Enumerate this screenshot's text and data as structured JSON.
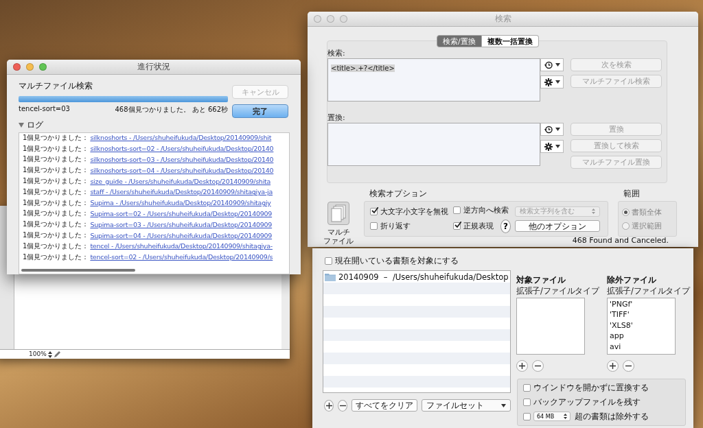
{
  "background_window": {
    "zoom": "100%"
  },
  "progress_window": {
    "title": "進行状況",
    "heading": "マルチファイル検索",
    "cancel_button": {
      "label": "キャンセル",
      "disabled": true
    },
    "progress": {
      "level": 1
    },
    "current_file": "tencel-sort=03",
    "status": "468個見つかりました。 あと 662秒",
    "done_button": "完了",
    "log": {
      "label": "ログ",
      "expanded": true,
      "entries": [
        {
          "prefix": "1個見つかりました：",
          "link": "silknoshorts  -  /Users/shuheifukuda/Desktop/20140909/shit"
        },
        {
          "prefix": "1個見つかりました：",
          "link": "silknoshorts-sort=02  -  /Users/shuheifukuda/Desktop/20140"
        },
        {
          "prefix": "1個見つかりました：",
          "link": "silknoshorts-sort=03  -  /Users/shuheifukuda/Desktop/20140"
        },
        {
          "prefix": "1個見つかりました：",
          "link": "silknoshorts-sort=04  -  /Users/shuheifukuda/Desktop/20140"
        },
        {
          "prefix": "1個見つかりました：",
          "link": "size_guide  -  /Users/shuheifukuda/Desktop/20140909/shita"
        },
        {
          "prefix": "1個見つかりました：",
          "link": "staff  -  /Users/shuheifukuda/Desktop/20140909/shitagiya-ja"
        },
        {
          "prefix": "1個見つかりました：",
          "link": "Supima  -  /Users/shuheifukuda/Desktop/20140909/shitagiy"
        },
        {
          "prefix": "1個見つかりました：",
          "link": "Supima-sort=02  -  /Users/shuheifukuda/Desktop/20140909"
        },
        {
          "prefix": "1個見つかりました：",
          "link": "Supima-sort=03  -  /Users/shuheifukuda/Desktop/20140909"
        },
        {
          "prefix": "1個見つかりました：",
          "link": "Supima-sort=04  -  /Users/shuheifukuda/Desktop/20140909"
        },
        {
          "prefix": "1個見つかりました：",
          "link": "tencel  -  /Users/shuheifukuda/Desktop/20140909/shitagiya-"
        },
        {
          "prefix": "1個見つかりました：",
          "link": "tencel-sort=02  -  /Users/shuheifukuda/Desktop/20140909/s"
        }
      ]
    }
  },
  "search_window": {
    "title": "検索",
    "tabs": [
      {
        "label": "検索/置換",
        "selected": true
      },
      {
        "label": "複数一括置換",
        "selected": false
      }
    ],
    "find": {
      "label": "検索:",
      "value": "<title>.+?</title>",
      "buttons": [
        {
          "label": "次を検索",
          "disabled": true
        },
        {
          "label": "マルチファイル検索",
          "disabled": true
        }
      ]
    },
    "replace": {
      "label": "置換:",
      "buttons": [
        {
          "label": "置換",
          "disabled": true
        },
        {
          "label": "置換して検索",
          "disabled": true
        },
        {
          "label": "マルチファイル置換",
          "disabled": true
        }
      ]
    },
    "multi_file_toggle": {
      "label_lines": [
        "マルチ",
        "ファイル"
      ]
    },
    "options": {
      "title": "検索オプション",
      "checkboxes": [
        {
          "label": "大文字小文字を無視",
          "checked": true
        },
        {
          "label": "逆方向へ検索",
          "checked": false
        },
        {
          "label": "折り返す",
          "checked": false
        },
        {
          "label": "正規表現",
          "checked": true
        }
      ],
      "match_popup": {
        "value": "検索文字列を含む",
        "disabled": true
      },
      "help": "?",
      "more_button": "他のオプション"
    },
    "scope": {
      "title": "範囲",
      "disabled": true,
      "radios": [
        {
          "label": "書類全体",
          "selected": true
        },
        {
          "label": "選択範囲",
          "selected": false
        }
      ]
    },
    "status": "468 Found and Canceled."
  },
  "multi_file_drawer": {
    "open_documents": {
      "label": "現在開いている書類を対象にする",
      "checked": false
    },
    "folders": [
      {
        "name": "20140909  –  /Users/shuheifukuda/Desktop"
      }
    ],
    "clear_button": "すべてをクリア",
    "fileset_popup": "ファイルセット",
    "target_files": {
      "title": "対象ファイル",
      "subtitle": "拡張子/ファイルタイプ"
    },
    "exclude_files": {
      "title": "除外ファイル",
      "subtitle": "拡張子/ファイルタイプ",
      "items": [
        "'PNGf'",
        "'TIFF'",
        "'XLS8'",
        "app",
        "avi"
      ]
    },
    "settings": [
      {
        "kind": "check",
        "label": "ウインドウを開かずに置換する",
        "checked": false
      },
      {
        "kind": "check",
        "label": "バックアップファイルを残す",
        "checked": false
      },
      {
        "kind": "size",
        "size": "64 MB",
        "label": "超の書類は除外する",
        "checked": false
      }
    ]
  }
}
